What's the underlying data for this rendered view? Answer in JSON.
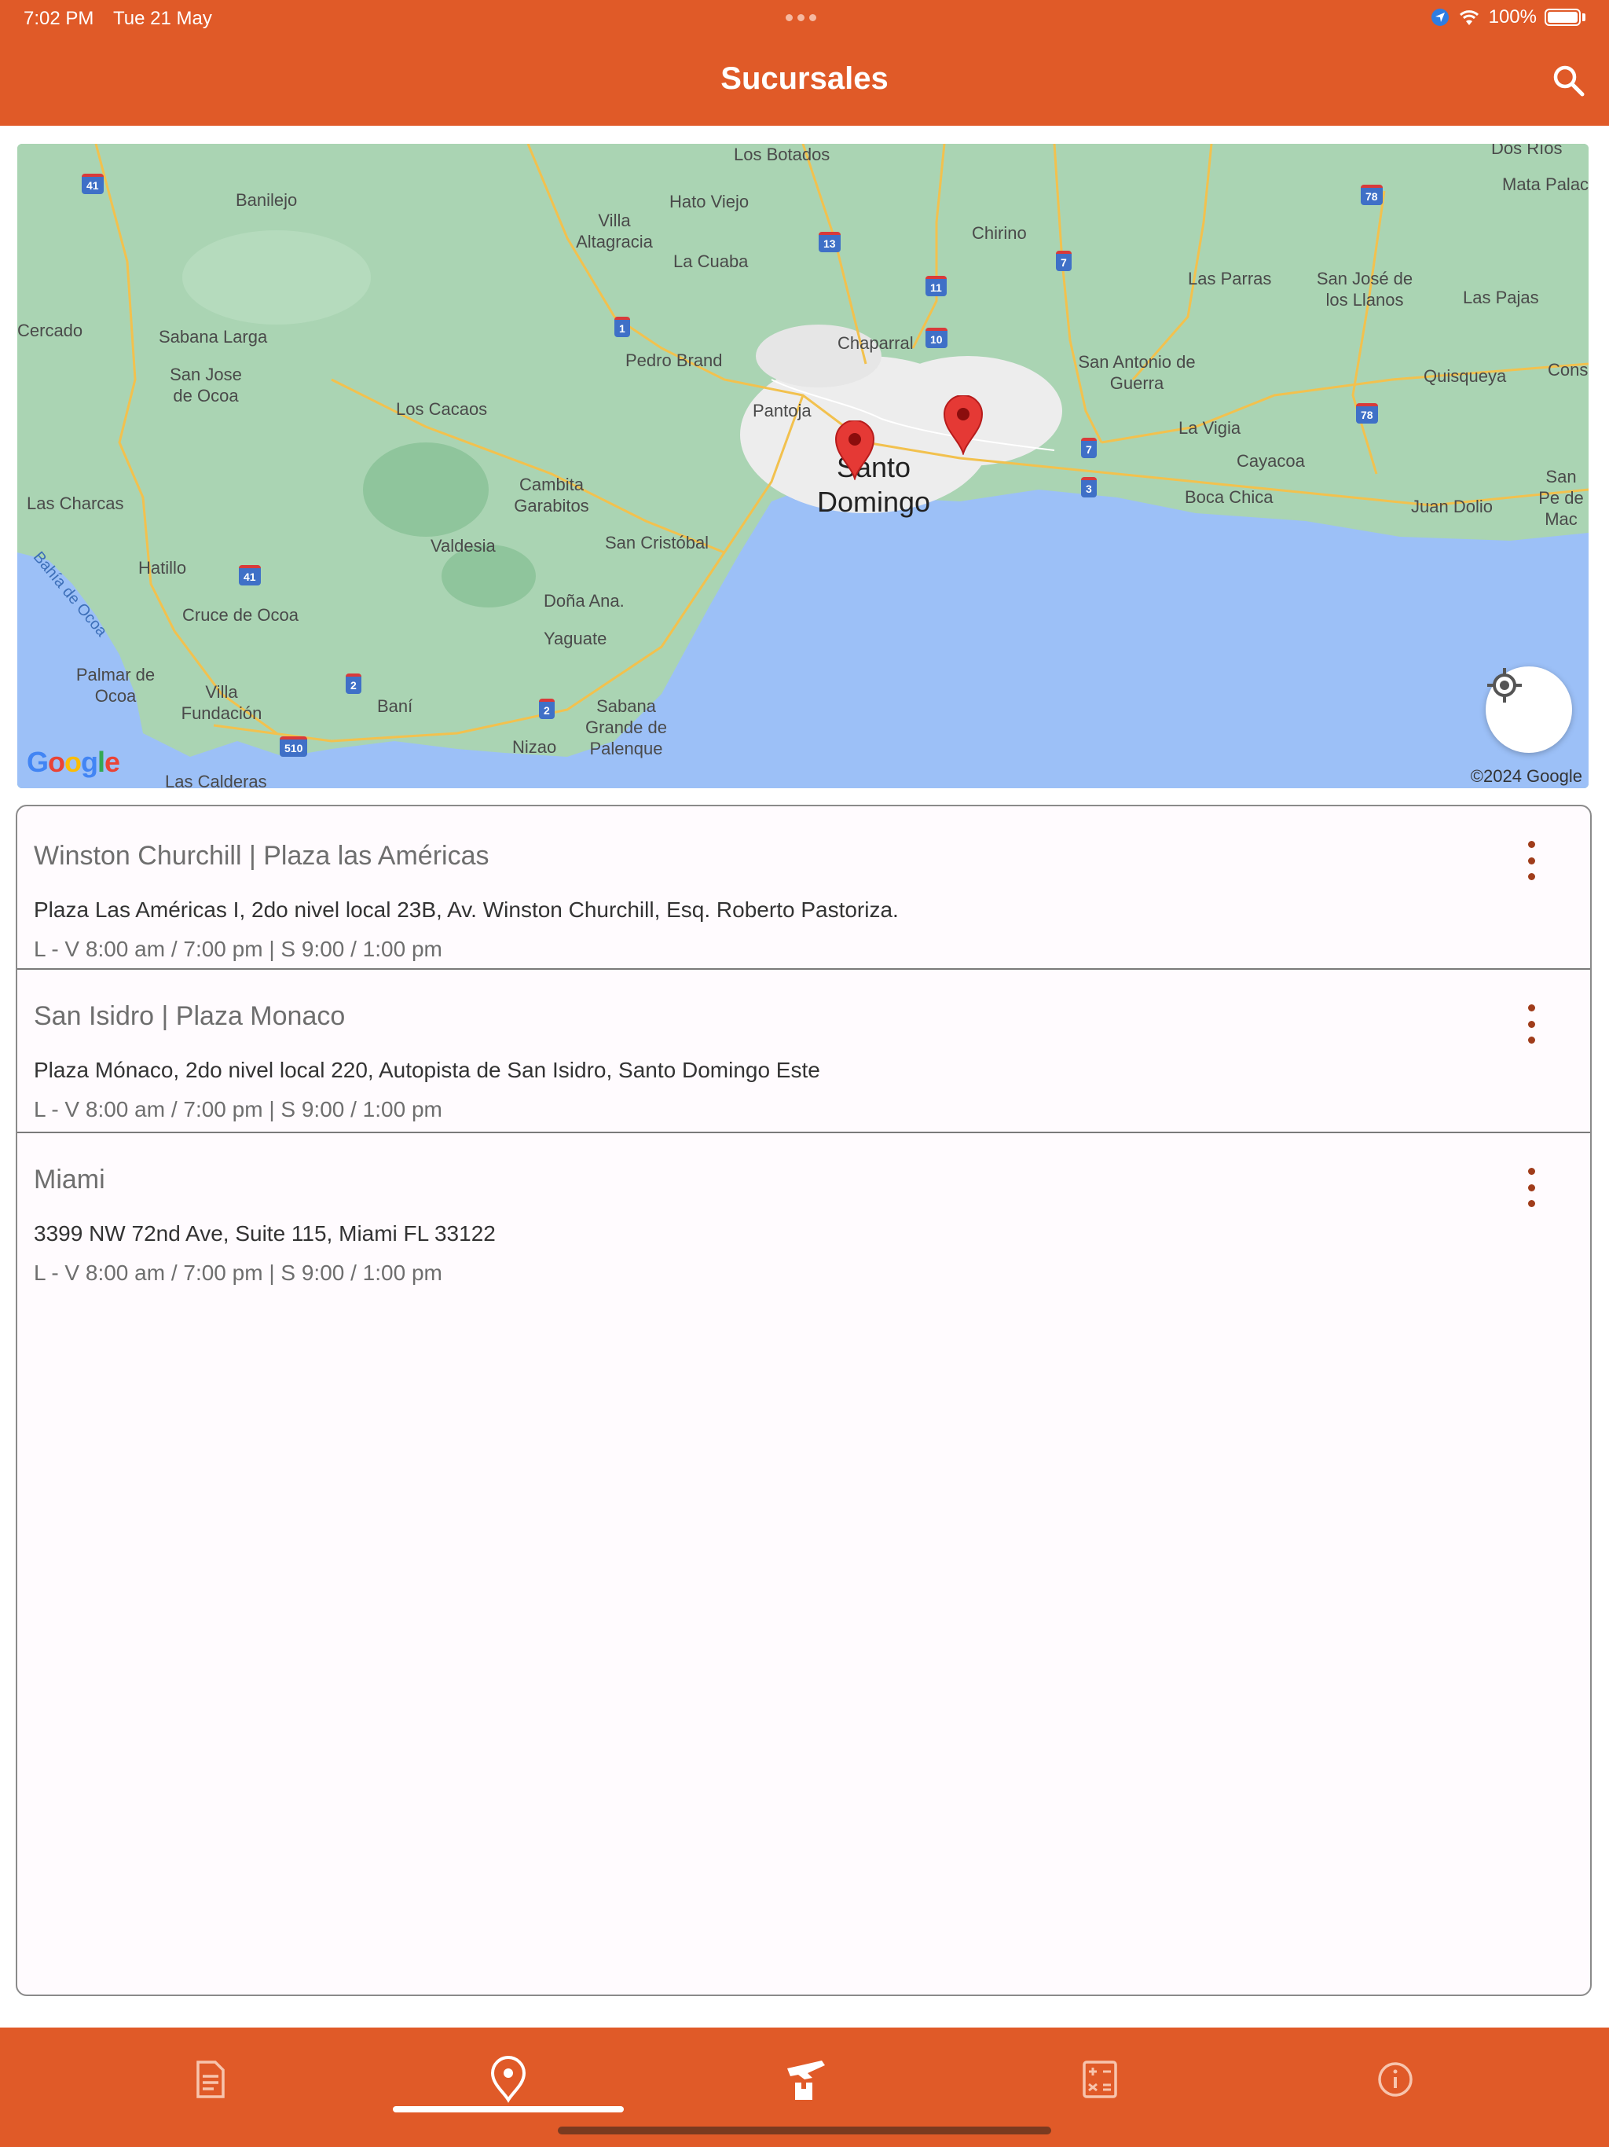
{
  "status": {
    "time": "7:02 PM",
    "date": "Tue 21 May",
    "battery": "100%"
  },
  "header": {
    "title": "Sucursales"
  },
  "map": {
    "places": [
      "Los Botados",
      "Hato Viejo",
      "Villa Altagracia",
      "La Cuaba",
      "Chirino",
      "Banilejo",
      "Cercado",
      "Sabana Larga",
      "San Jose de Ocoa",
      "Los Cacaos",
      "Pedro Brand",
      "Chaparral",
      "Pantoja",
      "Santo Domingo",
      "San Antonio de Guerra",
      "Las Parras",
      "San José de los Llanos",
      "Las Pajas",
      "Mata Palac",
      "Quisqueya",
      "Cons",
      "La Vigia",
      "Cayacoa",
      "Boca Chica",
      "Juan Dolio",
      "San Pe de Mac",
      "Las Charcas",
      "Cambita Garabitos",
      "Valdesia",
      "San Cristóbal",
      "Hatillo",
      "Cruce de Ocoa",
      "Doña Ana.",
      "Yaguate",
      "Palmar de Ocoa",
      "Villa Fundación",
      "Baní",
      "Sabana Grande de Palenque",
      "Nizao",
      "Las Calderas",
      "Bahía de Ocoa",
      "Dos Ríos"
    ],
    "highways": [
      "41",
      "78",
      "13",
      "11",
      "10",
      "7",
      "1",
      "41",
      "2",
      "2",
      "510",
      "7",
      "3",
      "78"
    ],
    "google_logo": "Google",
    "copyright": "©2024 Google"
  },
  "branches": [
    {
      "name": "Winston Churchill | Plaza las Américas",
      "address": "Plaza Las Américas I, 2do nivel local 23B, Av. Winston Churchill, Esq. Roberto Pastoriza.",
      "hours": "L - V 8:00 am / 7:00 pm | S 9:00 / 1:00 pm"
    },
    {
      "name": "San Isidro | Plaza Monaco",
      "address": "Plaza Mónaco, 2do nivel local 220, Autopista de San Isidro, Santo Domingo Este",
      "hours": "L - V 8:00 am / 7:00 pm | S 9:00 / 1:00 pm"
    },
    {
      "name": "Miami",
      "address": "3399 NW 72nd Ave, Suite 115, Miami FL 33122",
      "hours": "L - V 8:00 am / 7:00 pm | S 9:00 / 1:00 pm"
    }
  ],
  "nav": {
    "items": [
      "document-icon",
      "location-pin-icon",
      "airplane-box-icon",
      "calculator-icon",
      "info-icon"
    ],
    "active": "location-pin-icon"
  }
}
